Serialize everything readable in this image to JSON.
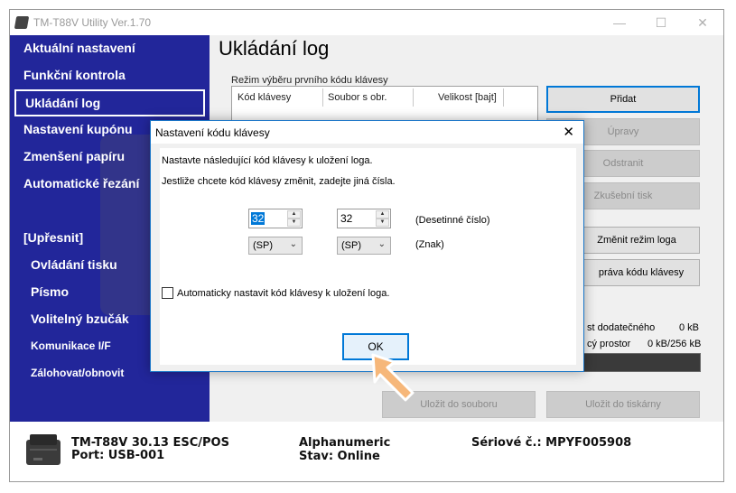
{
  "window": {
    "title": "TM-T88V Utility Ver.1.70"
  },
  "sidebar": {
    "items": [
      {
        "label": "Aktuální nastavení"
      },
      {
        "label": "Funkční kontrola"
      },
      {
        "label": "Ukládání log"
      },
      {
        "label": "Nastavení kupónu"
      },
      {
        "label": "Zmenšení papíru"
      },
      {
        "label": "Automatické řezání"
      }
    ],
    "section_label": "[Upřesnit]",
    "subitems": [
      {
        "label": "Ovládání tisku"
      },
      {
        "label": "Písmo"
      },
      {
        "label": "Volitelný bzučák"
      },
      {
        "label": "Komunikace I/F"
      },
      {
        "label": "Zálohovat/obnovit"
      }
    ]
  },
  "main": {
    "title": "Ukládání log",
    "mode_label": "Režim výběru prvního kódu klávesy",
    "table_headers": [
      "Kód klávesy",
      "Soubor s obr.",
      "Velikost [bajt]"
    ],
    "buttons": {
      "add": "Přidat",
      "edit": "Úpravy",
      "delete": "Odstranit",
      "test_print": "Zkušební tisk",
      "change_mode": "Změnit režim loga",
      "key_code_mgmt": "práva kódu klávesy",
      "save_to_file": "Uložit do souboru",
      "save_to_printer": "Uložit do tiskárny"
    },
    "stats": {
      "extra_label": "st dodatečného",
      "extra_value": "0 kB",
      "space_label": "cý prostor",
      "space_value": "0 kB/256 kB"
    }
  },
  "status": {
    "model": "TM-T88V 30.13 ESC/POS",
    "port": "Port: USB-001",
    "mode": "Alphanumeric",
    "state": "Stav: Online",
    "serial": "Sériové č.: MPYF005908"
  },
  "dialog": {
    "title": "Nastavení kódu klávesy",
    "line1": "Nastavte následující kód klávesy k uložení loga.",
    "line2": "Jestliže chcete kód klávesy změnit, zadejte jiná čísla.",
    "spin1_value": "32",
    "spin2_value": "32",
    "decimal_label": "(Desetinné číslo)",
    "combo1_value": "(SP)",
    "combo2_value": "(SP)",
    "char_label": "(Znak)",
    "checkbox_label": "Automaticky nastavit kód klávesy k uložení loga.",
    "ok_label": "OK"
  }
}
